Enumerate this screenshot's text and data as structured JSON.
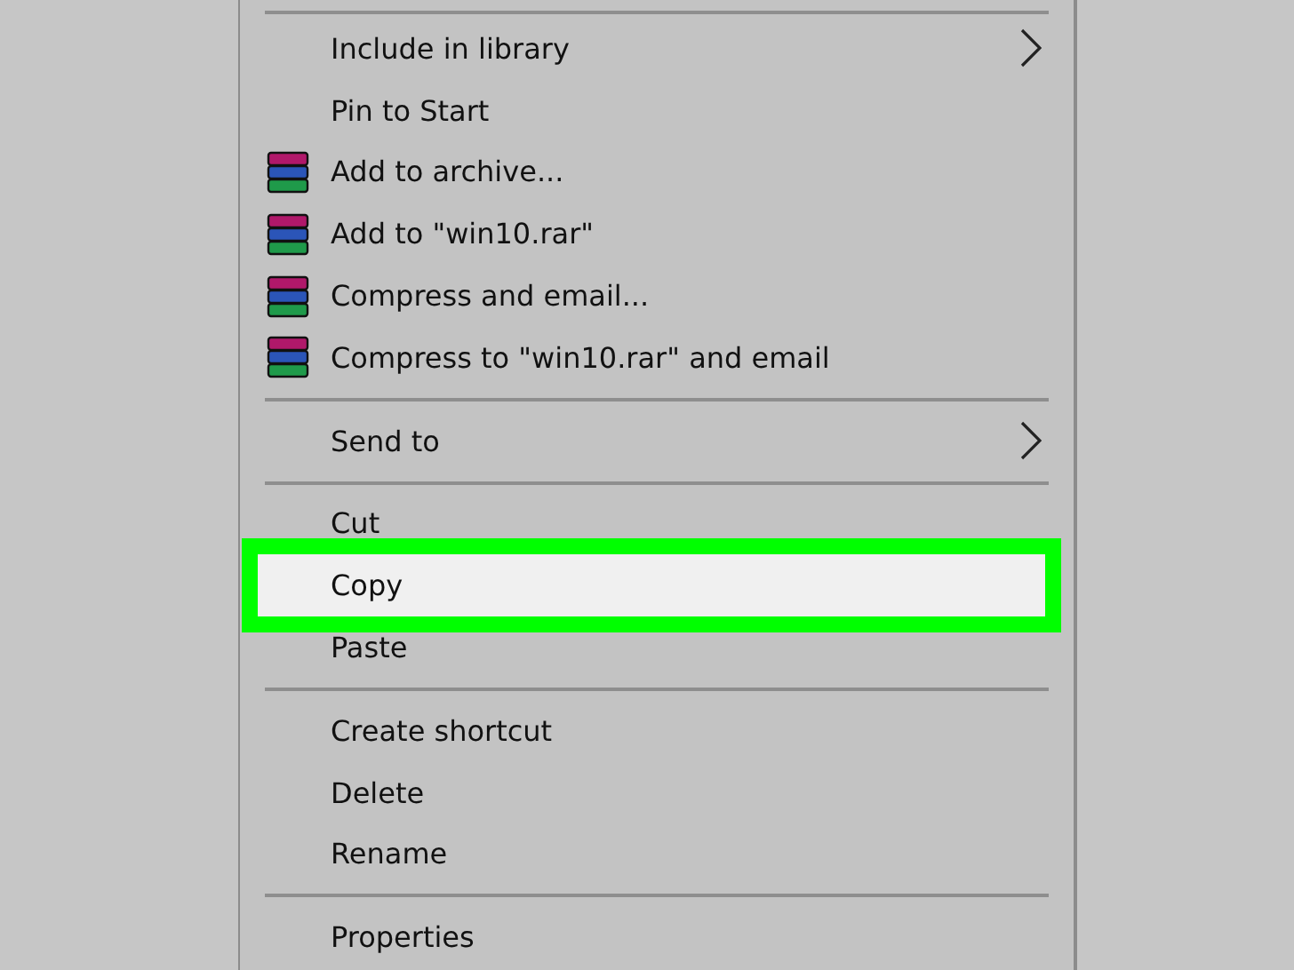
{
  "context_menu": {
    "items": [
      {
        "kind": "separator"
      },
      {
        "kind": "item",
        "label": "Include in library",
        "submenu": true,
        "selected": false
      },
      {
        "kind": "item",
        "label": "Pin to Start",
        "submenu": false,
        "selected": false
      },
      {
        "kind": "archive_item",
        "label": "Add to archive...",
        "submenu": false,
        "selected": false
      },
      {
        "kind": "archive_item",
        "label": "Add to \"win10.rar\"",
        "submenu": false,
        "selected": false
      },
      {
        "kind": "archive_item",
        "label": "Compress and email...",
        "submenu": false,
        "selected": false
      },
      {
        "kind": "archive_item",
        "label": "Compress to \"win10.rar\" and email",
        "submenu": false,
        "selected": false
      },
      {
        "kind": "separator"
      },
      {
        "kind": "item",
        "label": "Send to",
        "submenu": true,
        "selected": false
      },
      {
        "kind": "separator"
      },
      {
        "kind": "item",
        "label": "Cut",
        "submenu": false,
        "selected": false
      },
      {
        "kind": "item",
        "label": "Copy",
        "submenu": false,
        "selected": true
      },
      {
        "kind": "item",
        "label": "Paste",
        "submenu": false,
        "selected": false
      },
      {
        "kind": "separator"
      },
      {
        "kind": "item",
        "label": "Create shortcut",
        "submenu": false,
        "selected": false
      },
      {
        "kind": "item",
        "label": "Delete",
        "submenu": false,
        "selected": false
      },
      {
        "kind": "item",
        "label": "Rename",
        "submenu": false,
        "selected": false
      },
      {
        "kind": "separator"
      },
      {
        "kind": "item",
        "label": "Properties",
        "submenu": false,
        "selected": false
      }
    ]
  }
}
